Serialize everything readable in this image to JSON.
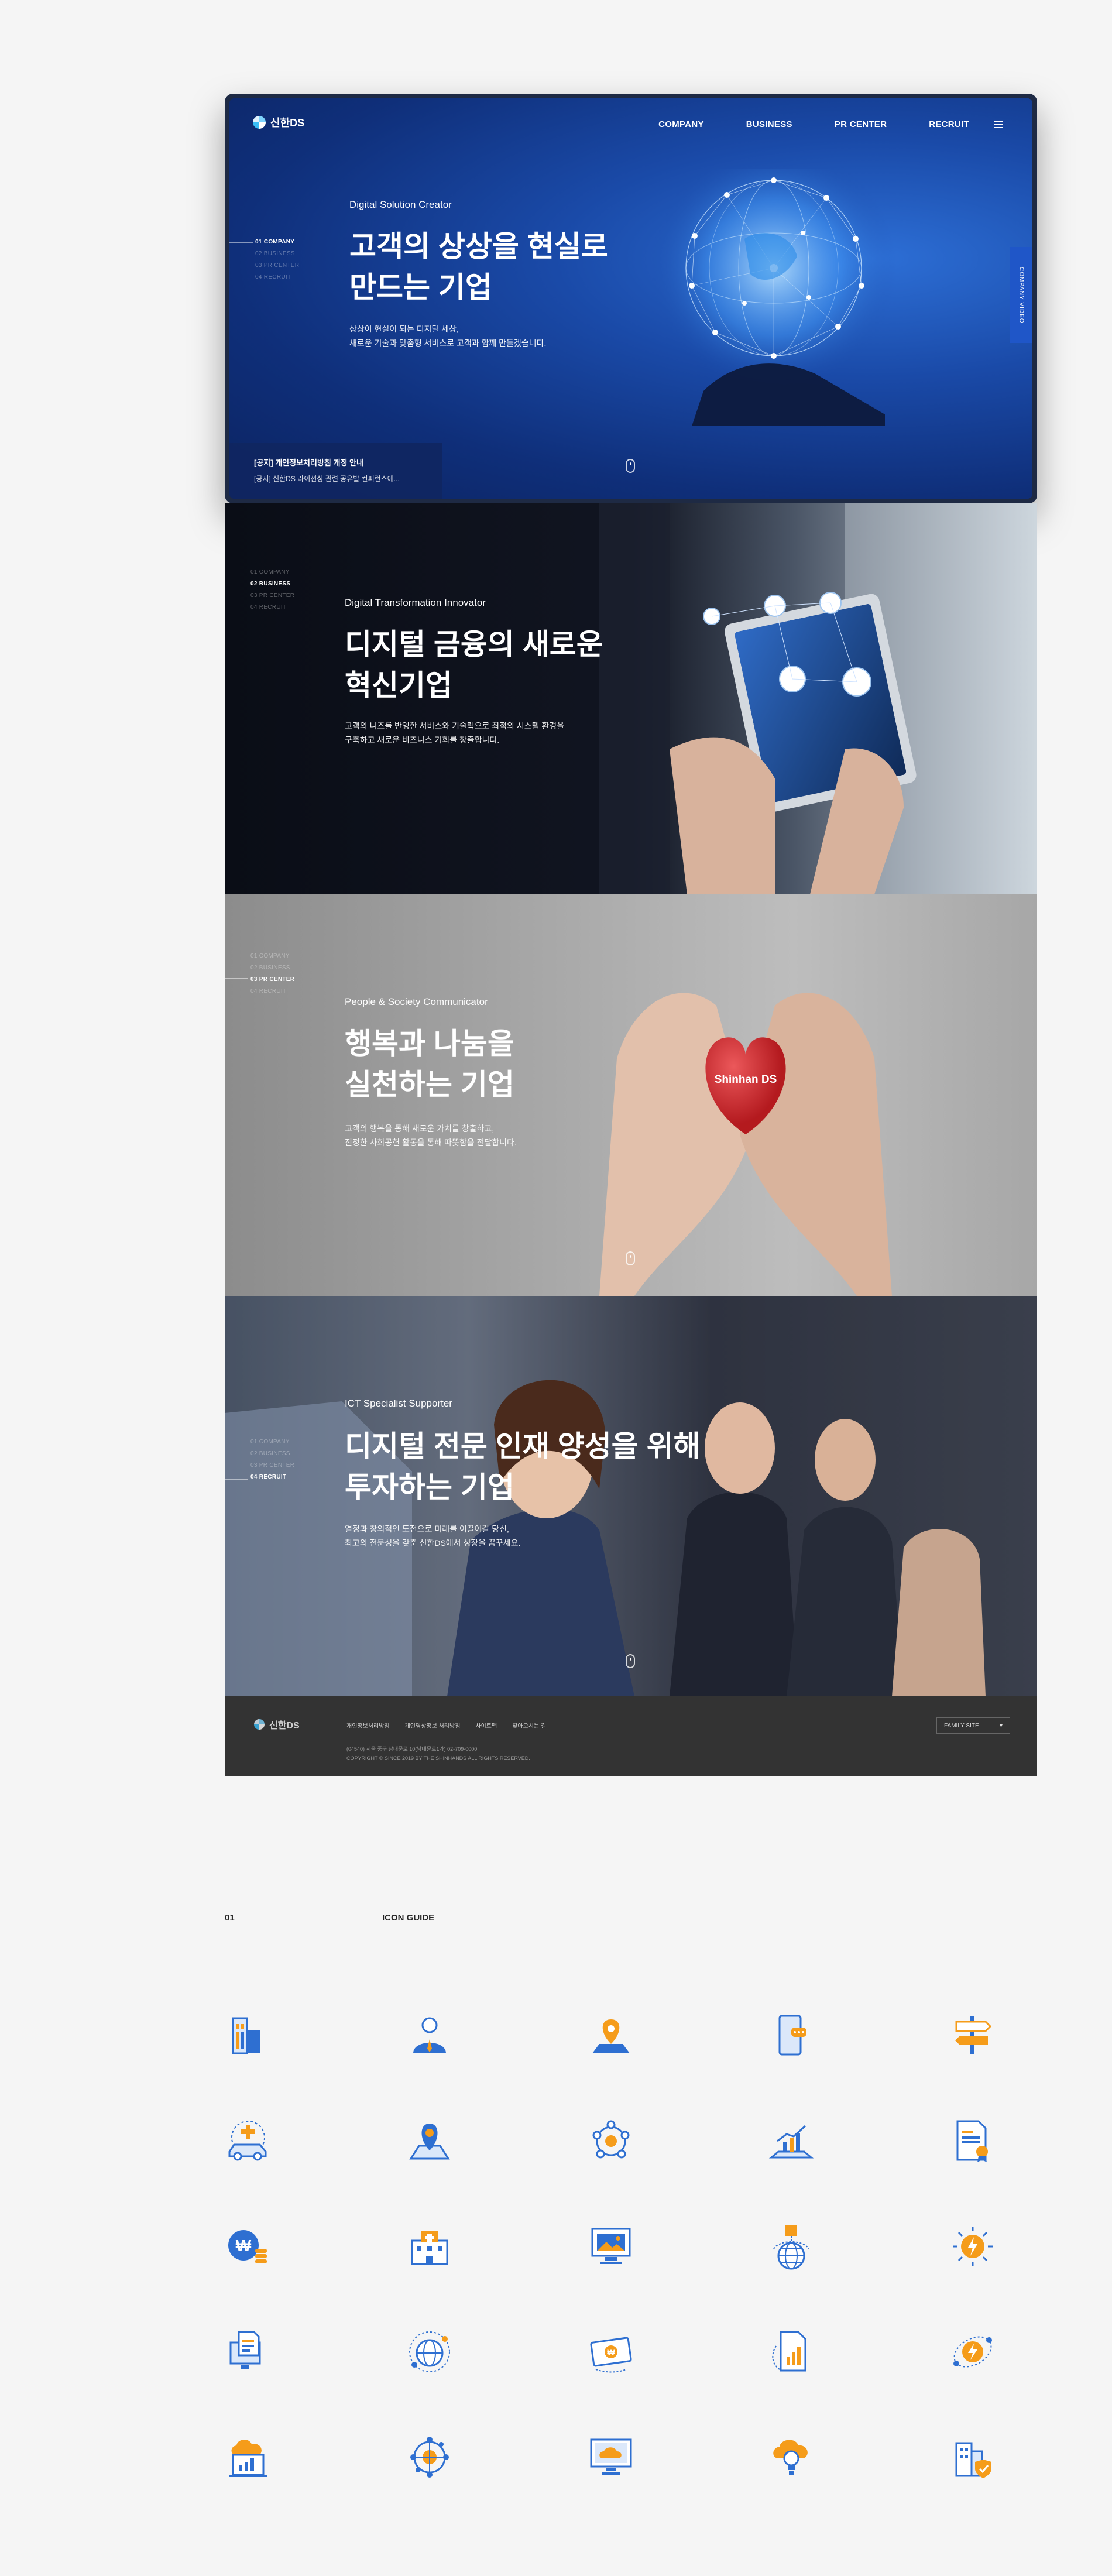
{
  "header": {
    "logo_text": "신한DS",
    "nav": [
      "COMPANY",
      "BUSINESS",
      "PR CENTER",
      "RECRUIT"
    ]
  },
  "sidenav": [
    "01 COMPANY",
    "02 BUSINESS",
    "03 PR CENTER",
    "04 RECRUIT"
  ],
  "sections": [
    {
      "eyebrow": "Digital Solution Creator",
      "headline_1": "고객의 상상을 현실로",
      "headline_2": "만드는 기업",
      "copy_1": "상상이 현실이 되는 디지털 세상,",
      "copy_2": "새로운 기술과 맞춤형 서비스로 고객과 함께 만들겠습니다.",
      "active": "01 COMPANY"
    },
    {
      "eyebrow": "Digital Transformation Innovator",
      "headline_1": "디지털 금융의 새로운",
      "headline_2": "혁신기업",
      "copy_1": "고객의 니즈를 반영한 서비스와 기술력으로 최적의 시스템 환경을",
      "copy_2": "구축하고 새로운 비즈니스 기회를 창출합니다.",
      "active": "02 BUSINESS"
    },
    {
      "eyebrow": "People & Society Communicator",
      "headline_1": "행복과 나눔을",
      "headline_2": "실천하는 기업",
      "copy_1": "고객의 행복을 통해 새로운 가치를 창출하고,",
      "copy_2": "진정한 사회공헌 활동을 통해 따뜻함을 전달합니다.",
      "active": "03 PR CENTER",
      "heart_label": "Shinhan DS"
    },
    {
      "eyebrow": "ICT Specialist Supporter",
      "headline_1": "디지털 전문 인재 양성을 위해",
      "headline_2": "투자하는 기업",
      "copy_1": "열정과 창의적인 도전으로 미래를 이끌어갈 당신,",
      "copy_2": "최고의 전문성을 갖춘 신한DS에서 성장을 꿈꾸세요.",
      "active": "04 RECRUIT"
    }
  ],
  "notice": {
    "line1": "[공지] 개인정보처리방침 개정 안내",
    "line2": "[공지] 신한DS 라이선싱 관련 공유발 컨퍼런스에..."
  },
  "side_tab": "COMPANY VIDEO",
  "footer": {
    "logo_text": "신한DS",
    "links": [
      "개인정보처리방침",
      "개인영상정보 처리방침",
      "사이트맵",
      "찾아오시는 길"
    ],
    "address": "(04540) 서울 중구 남대문로 10(남대문로1가) 02-709-0000",
    "copyright": "COPYRIGHT © SINCE 2019 BY THE SHINHANDS ALL RIGHTS RESERVED.",
    "family_site": "FAMILY SITE"
  },
  "icon_guide": {
    "number": "01",
    "title": "ICON GUIDE",
    "icons": [
      "building-icon",
      "person-icon",
      "location-pin-icon",
      "mobile-chat-icon",
      "signpost-icon",
      "car-insurance-icon",
      "map-marker-icon",
      "network-people-icon",
      "bar-chart-rise-icon",
      "document-certificate-icon",
      "won-coin-icon",
      "hospital-icon",
      "monitor-image-icon",
      "globe-box-icon",
      "lightning-sun-icon",
      "document-monitor-icon",
      "globe-orbit-icon",
      "money-card-icon",
      "report-chart-icon",
      "energy-orbit-icon",
      "cloud-chart-icon",
      "network-globe-icon",
      "cloud-monitor-icon",
      "cloud-bulb-icon",
      "building-shield-icon"
    ]
  },
  "colors": {
    "brand_blue": "#1f56c8",
    "icon_blue": "#2e6fd1",
    "icon_orange": "#f59c1a"
  }
}
